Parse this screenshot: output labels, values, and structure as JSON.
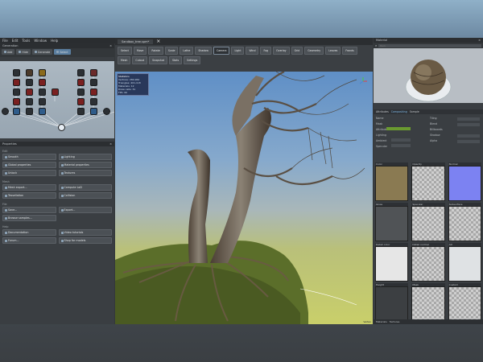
{
  "menu": [
    "File",
    "Edit",
    "Tools",
    "Window",
    "Help"
  ],
  "left": {
    "graph_header": "Generation",
    "graph_buttons": [
      "Add",
      "Hide",
      "Generate",
      "Select"
    ],
    "props_header": "Properties",
    "sections": [
      {
        "title": "Edit",
        "rows": [
          [
            "Smooth",
            "Lighting"
          ],
          [
            "Global properties",
            "Material properties"
          ],
          [
            "Unlock",
            "Textures"
          ]
        ]
      },
      {
        "title": "Mesh",
        "rows": [
          [
            "Mesh export...",
            "Compute LoD"
          ],
          [
            "Tessellation",
            "Collision"
          ]
        ]
      },
      {
        "title": "File",
        "rows": [
          [
            "Save...",
            "Export..."
          ],
          [
            "Browse samples..."
          ]
        ]
      },
      {
        "title": "Help",
        "rows": [
          [
            "Documentation",
            "Video tutorials"
          ],
          [
            "Forum...",
            "Shop for models"
          ]
        ]
      }
    ]
  },
  "center": {
    "doc_tab": "Sandbox_tree.spm*",
    "ribbon": [
      "Select",
      "Move",
      "Rotate",
      "Scale",
      "Lathe",
      "Shadow",
      "Camera",
      "Light",
      "Wind",
      "Fog",
      "Overlay",
      "Grid",
      "Geometry",
      "Leaves",
      "Fronds",
      "Mesh",
      "Cutout",
      "Snapshot",
      "Stats",
      "Settings"
    ],
    "overlay_lines": [
      "Statistics",
      "Vertices: 284,962",
      "Triangles: 401,118",
      "Materials: 12",
      "Draw calls: 31",
      "FPS: 60"
    ],
    "status": "Vertex"
  },
  "right": {
    "header": "Material",
    "search_placeholder": "Bark",
    "material_tabs": [
      "Attributes",
      "Compositing",
      "Sample"
    ],
    "props_left": [
      "Name",
      "Mask",
      "Attributes",
      "Lighting",
      "Ambient",
      "Specular"
    ],
    "props_right": [
      "Tiling",
      "Blend",
      "Billboards",
      "Shadow",
      "Alpha"
    ],
    "slots": [
      "Color",
      "Opacity",
      "Normal",
      "Gloss",
      "Specular",
      "Subsurface",
      "Detail color",
      "Detail normal",
      "AO",
      "Height",
      "Mask",
      "Custom"
    ],
    "bottom_tabs": [
      "Materials",
      "Textures"
    ]
  },
  "colors": {
    "accent": "#5a7ea0",
    "panel": "#3a3e42",
    "sky_top": "#5f8fc6"
  }
}
